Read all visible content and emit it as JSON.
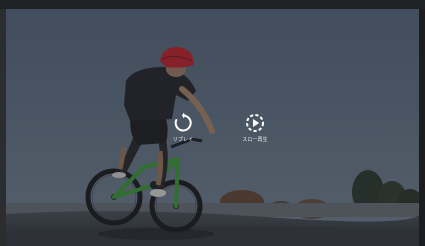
{
  "player": {
    "controls": {
      "replay_label": "リプレイ",
      "slowmo_label": "スロー再生"
    },
    "icons": {
      "replay": "replay-icon",
      "slowmo": "slow-motion-icon"
    },
    "colors": {
      "overlay": "#1a1e24",
      "icon": "#ffffff",
      "frame_green": "#3fa03a",
      "helmet_red": "#c8242e"
    }
  }
}
